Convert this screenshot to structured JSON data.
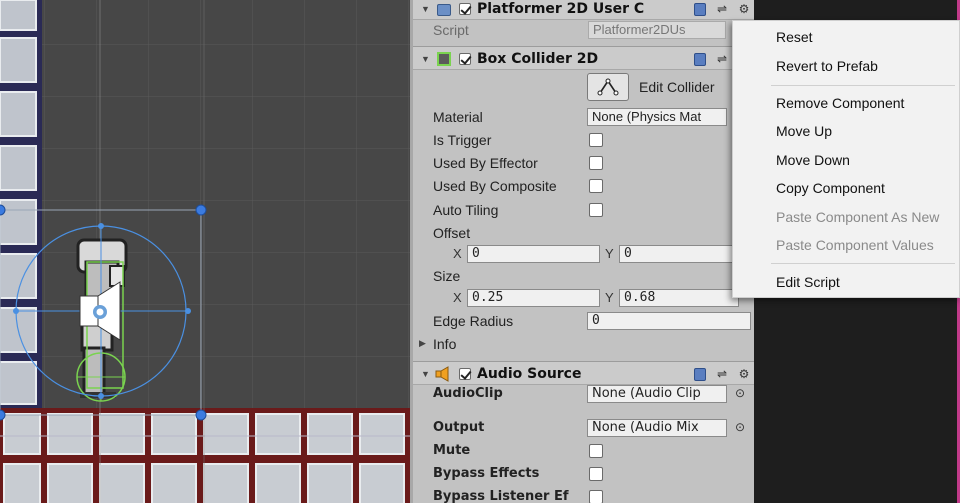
{
  "platformer": {
    "title": "Platformer 2D User C",
    "script_label": "Script",
    "script_value": "Platformer2DUs"
  },
  "box_collider": {
    "title": "Box Collider 2D",
    "edit_collider_label": "Edit Collider",
    "material_label": "Material",
    "material_value": "None (Physics Mat",
    "is_trigger_label": "Is Trigger",
    "used_by_effector_label": "Used By Effector",
    "used_by_composite_label": "Used By Composite",
    "auto_tiling_label": "Auto Tiling",
    "offset_label": "Offset",
    "offset_x_label": "X",
    "offset_x": "0",
    "offset_y_label": "Y",
    "offset_y": "0",
    "size_label": "Size",
    "size_x_label": "X",
    "size_x": "0.25",
    "size_y_label": "Y",
    "size_y": "0.68",
    "edge_radius_label": "Edge Radius",
    "edge_radius": "0",
    "info_label": "Info"
  },
  "audio_source": {
    "title": "Audio Source",
    "audioclip_label": "AudioClip",
    "audioclip_value": "None (Audio Clip",
    "output_label": "Output",
    "output_value": "None (Audio Mix",
    "mute_label": "Mute",
    "bypass_effects_label": "Bypass Effects",
    "bypass_listener_label": "Bypass Listener Ef"
  },
  "context_menu": {
    "reset": "Reset",
    "revert_to_prefab": "Revert to Prefab",
    "remove_component": "Remove Component",
    "move_up": "Move Up",
    "move_down": "Move Down",
    "copy_component": "Copy Component",
    "paste_as_new": "Paste Component As New",
    "paste_values": "Paste Component Values",
    "edit_script": "Edit Script"
  },
  "icons": {
    "help": "book-icon",
    "preset": "sliders-icon",
    "settings": "gear-icon",
    "edit_collider": "polygon-edit-icon",
    "audio": "speaker-icon",
    "object_picker": "circle-dot-icon"
  },
  "colors": {
    "scene_bg": "#474747",
    "inspector_bg": "#c2c2c2",
    "menu_bg": "#f2f2f2",
    "gizmo_blue": "#4a90e2",
    "collider_green": "#7ad34f"
  }
}
